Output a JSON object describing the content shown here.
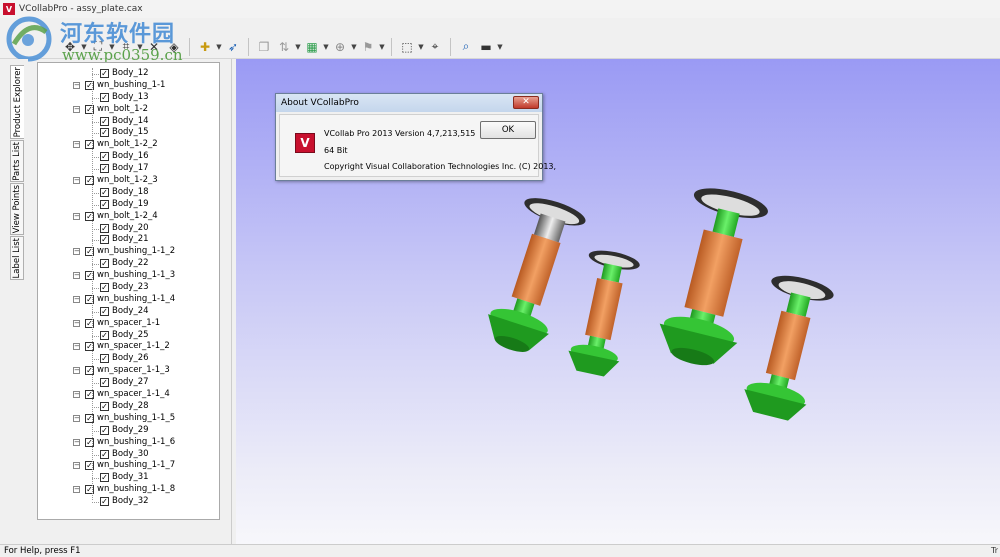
{
  "window": {
    "title": "VCollabPro - assy_plate.cax",
    "app_icon_letter": "V"
  },
  "watermark": {
    "title": "河东软件园",
    "url": "www.pc0359.cn"
  },
  "side_tabs": [
    "Product Explorer",
    "Parts List",
    "View Points",
    "Label List"
  ],
  "tree": [
    {
      "level": 2,
      "label": "Body_12",
      "checked": true
    },
    {
      "level": 1,
      "label": "wn_bushing_1-1",
      "checked": true,
      "expander": "−"
    },
    {
      "level": 2,
      "label": "Body_13",
      "checked": true
    },
    {
      "level": 1,
      "label": "wn_bolt_1-2",
      "checked": true,
      "expander": "−"
    },
    {
      "level": 2,
      "label": "Body_14",
      "checked": true
    },
    {
      "level": 2,
      "label": "Body_15",
      "checked": true
    },
    {
      "level": 1,
      "label": "wn_bolt_1-2_2",
      "checked": true,
      "expander": "−"
    },
    {
      "level": 2,
      "label": "Body_16",
      "checked": true
    },
    {
      "level": 2,
      "label": "Body_17",
      "checked": true
    },
    {
      "level": 1,
      "label": "wn_bolt_1-2_3",
      "checked": true,
      "expander": "−"
    },
    {
      "level": 2,
      "label": "Body_18",
      "checked": true
    },
    {
      "level": 2,
      "label": "Body_19",
      "checked": true
    },
    {
      "level": 1,
      "label": "wn_bolt_1-2_4",
      "checked": true,
      "expander": "−"
    },
    {
      "level": 2,
      "label": "Body_20",
      "checked": true
    },
    {
      "level": 2,
      "label": "Body_21",
      "checked": true
    },
    {
      "level": 1,
      "label": "wn_bushing_1-1_2",
      "checked": true,
      "expander": "−"
    },
    {
      "level": 2,
      "label": "Body_22",
      "checked": true
    },
    {
      "level": 1,
      "label": "wn_bushing_1-1_3",
      "checked": true,
      "expander": "−"
    },
    {
      "level": 2,
      "label": "Body_23",
      "checked": true
    },
    {
      "level": 1,
      "label": "wn_bushing_1-1_4",
      "checked": true,
      "expander": "−"
    },
    {
      "level": 2,
      "label": "Body_24",
      "checked": true
    },
    {
      "level": 1,
      "label": "wn_spacer_1-1",
      "checked": true,
      "expander": "−"
    },
    {
      "level": 2,
      "label": "Body_25",
      "checked": true
    },
    {
      "level": 1,
      "label": "wn_spacer_1-1_2",
      "checked": true,
      "expander": "−"
    },
    {
      "level": 2,
      "label": "Body_26",
      "checked": true
    },
    {
      "level": 1,
      "label": "wn_spacer_1-1_3",
      "checked": true,
      "expander": "−"
    },
    {
      "level": 2,
      "label": "Body_27",
      "checked": true
    },
    {
      "level": 1,
      "label": "wn_spacer_1-1_4",
      "checked": true,
      "expander": "−"
    },
    {
      "level": 2,
      "label": "Body_28",
      "checked": true
    },
    {
      "level": 1,
      "label": "wn_bushing_1-1_5",
      "checked": true,
      "expander": "−"
    },
    {
      "level": 2,
      "label": "Body_29",
      "checked": true
    },
    {
      "level": 1,
      "label": "wn_bushing_1-1_6",
      "checked": true,
      "expander": "−"
    },
    {
      "level": 2,
      "label": "Body_30",
      "checked": true
    },
    {
      "level": 1,
      "label": "wn_bushing_1-1_7",
      "checked": true,
      "expander": "−"
    },
    {
      "level": 2,
      "label": "Body_31",
      "checked": true
    },
    {
      "level": 1,
      "label": "wn_bushing_1-1_8",
      "checked": true,
      "expander": "−"
    },
    {
      "level": 2,
      "label": "Body_32",
      "checked": true
    }
  ],
  "about_dialog": {
    "title": "About VCollabPro",
    "close_glyph": "✕",
    "logo_letter": "V",
    "version": "VCollab Pro 2013 Version 4,7,213,515",
    "bits": "64 Bit",
    "copyright": "Copyright Visual Collaboration Technologies Inc.  (C) 2013,",
    "ok_label": "OK"
  },
  "statusbar": {
    "help_text": "For Help, press F1",
    "right_text": "Tr"
  },
  "colors": {
    "viewport_top": "#9a9af4",
    "viewport_bottom": "#f7f7fb",
    "orange_part": "#e07a3a",
    "green_part": "#3fd63f",
    "dialog_close": "#c0392b"
  }
}
